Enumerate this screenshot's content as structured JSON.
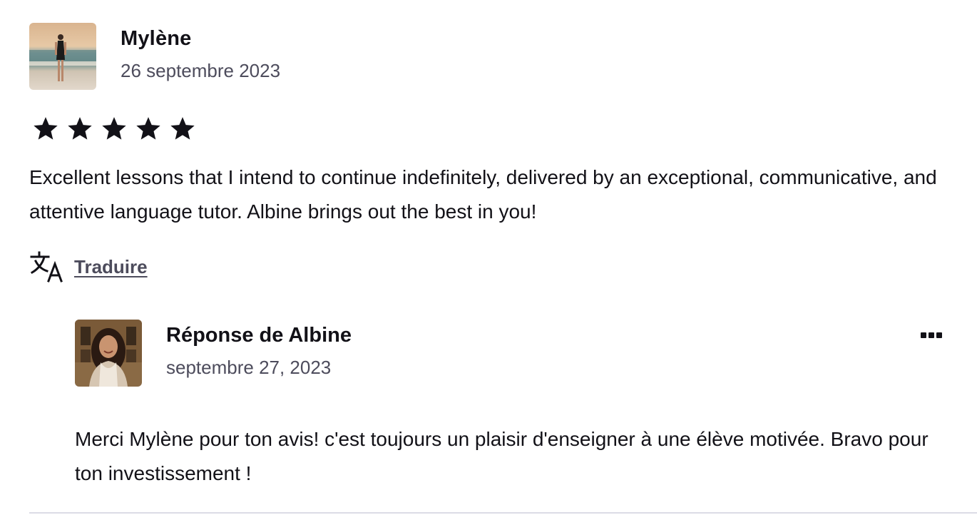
{
  "review": {
    "reviewer_name": "Mylène",
    "date": "26 septembre 2023",
    "rating": 5,
    "max_rating": 5,
    "text": "Excellent lessons that I intend to continue indefinitely, delivered by an exceptional, communicative, and attentive language tutor. Albine brings out the best in you!",
    "translate_label": "Traduire"
  },
  "reply": {
    "title": "Réponse de Albine",
    "date": "septembre 27, 2023",
    "text": "Merci Mylène pour ton avis! c'est toujours un plaisir d'enseigner à une élève motivée. Bravo pour ton investissement !"
  },
  "icons": {
    "star": "star-icon",
    "translate": "translate-icon",
    "more": "more-options-icon"
  },
  "colors": {
    "text_primary": "#121117",
    "text_secondary": "#4d4c5c",
    "divider": "#dcdce5"
  }
}
